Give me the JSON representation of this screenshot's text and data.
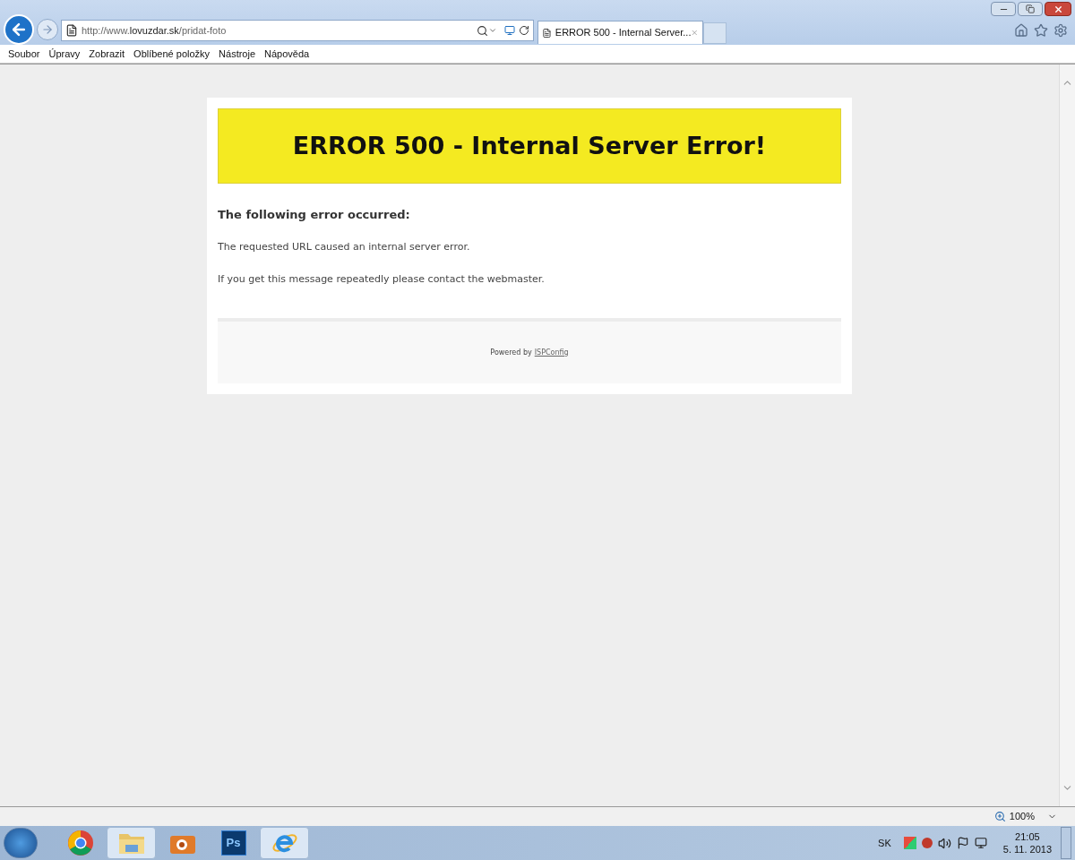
{
  "address_bar": {
    "url_prefix": "http://www.",
    "url_domain": "lovuzdar.sk",
    "url_path": "/pridat-foto"
  },
  "tabs": [
    {
      "title": "ERROR 500 - Internal Server...",
      "selected": true
    }
  ],
  "menu": [
    "Soubor",
    "Úpravy",
    "Zobrazit",
    "Oblíbené položky",
    "Nástroje",
    "Nápověda"
  ],
  "page": {
    "banner": "ERROR 500 - Internal Server Error!",
    "heading": "The following error occurred:",
    "paragraphs": [
      "The requested URL caused an internal server error.",
      "If you get this message repeatedly please contact the webmaster."
    ],
    "footer_text": "Powered by",
    "footer_link": "ISPConfig"
  },
  "status_bar": {
    "zoom": "100%"
  },
  "taskbar": {
    "apps": [
      {
        "kind": "chrome",
        "active": false
      },
      {
        "kind": "folder",
        "active": true
      },
      {
        "kind": "camera",
        "active": false
      },
      {
        "kind": "ps",
        "label": "Ps",
        "active": false
      },
      {
        "kind": "ie",
        "active": true
      }
    ],
    "language": "SK",
    "time": "21:05",
    "date": "5. 11. 2013"
  }
}
